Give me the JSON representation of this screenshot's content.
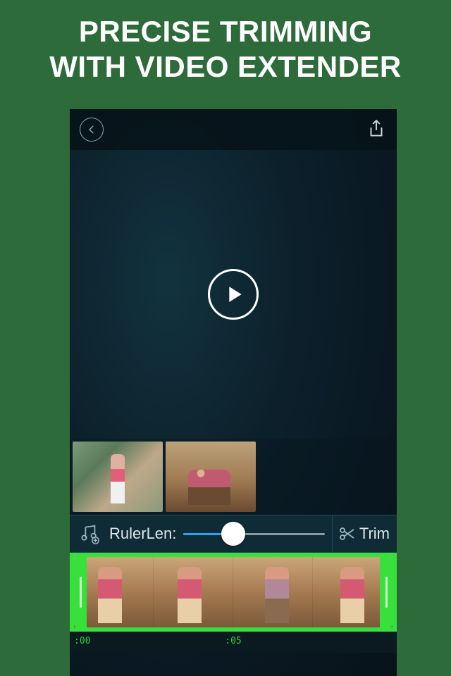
{
  "headline_line1": "PRECISE TRIMMING",
  "headline_line2": "WITH VIDEO EXTENDER",
  "controlbar": {
    "ruler_label": "RulerLen:",
    "trim_label": "Trim"
  },
  "slider": {
    "percent": 35
  },
  "timeruler": {
    "tick0": ":00",
    "tick5": ":05"
  }
}
